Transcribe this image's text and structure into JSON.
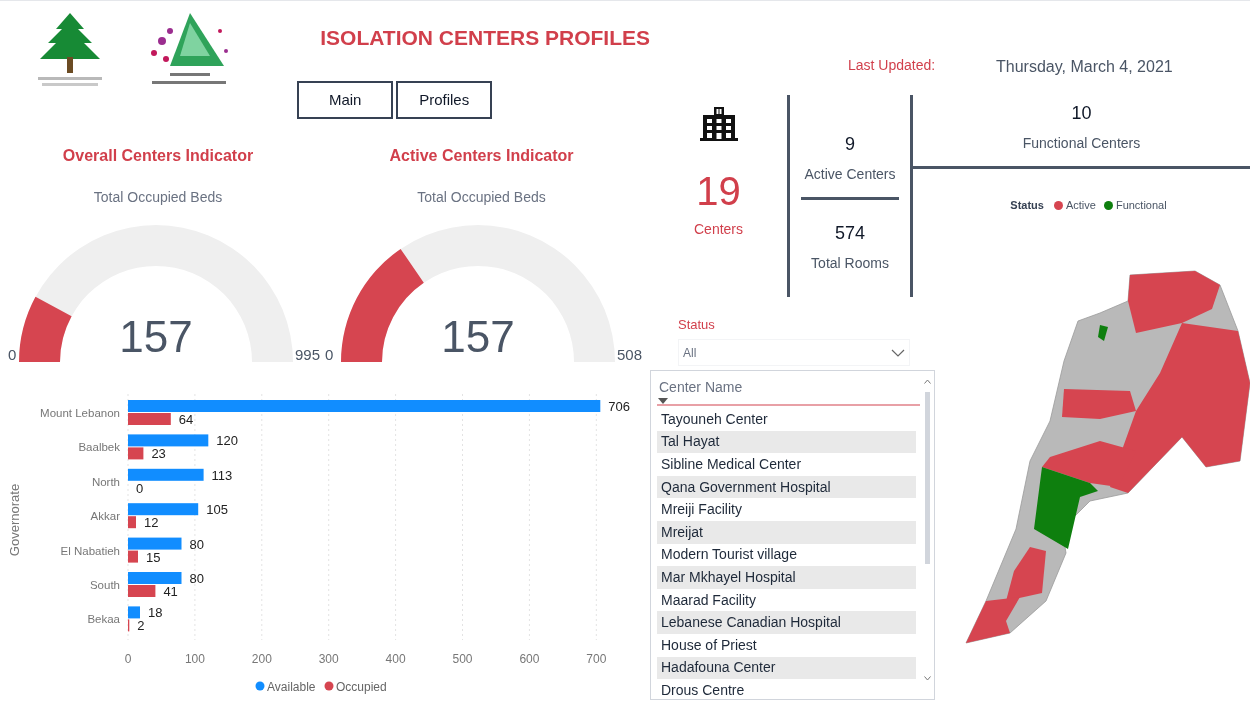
{
  "header": {
    "title": "ISOLATION CENTERS PROFILES",
    "nav_buttons": [
      {
        "label": "Main"
      },
      {
        "label": "Profiles"
      }
    ]
  },
  "last_updated": {
    "label": "Last Updated:",
    "date": "Thursday, March 4, 2021"
  },
  "gauges": [
    {
      "title": "Overall Centers Indicator",
      "subtitle": "Total Occupied Beds",
      "value": "157",
      "min": "0",
      "max": "995",
      "level": 0.158
    },
    {
      "title": "Active Centers Indicator",
      "subtitle": "Total Occupied Beds",
      "value": "157",
      "min": "0",
      "max": "508",
      "level": 0.309
    }
  ],
  "beds_chart": {
    "chart_data": {
      "type": "bar",
      "orientation": "horizontal",
      "ylabel": "Governorate",
      "categories": [
        "Mount Lebanon",
        "Baalbek",
        "North",
        "Akkar",
        "El Nabatieh",
        "South",
        "Bekaa"
      ],
      "series": [
        {
          "name": "Available",
          "color": "#118dff",
          "values": [
            706,
            120,
            113,
            105,
            80,
            80,
            18
          ]
        },
        {
          "name": "Occupied",
          "color": "#d64550",
          "values": [
            64,
            23,
            0,
            12,
            15,
            41,
            2
          ]
        }
      ],
      "xlim": [
        0,
        710
      ],
      "xticks": [
        {
          "value": 0,
          "label": "0"
        },
        {
          "value": 100,
          "label": "100"
        },
        {
          "value": 200,
          "label": "200"
        },
        {
          "value": 300,
          "label": "300"
        },
        {
          "value": 400,
          "label": "400"
        },
        {
          "value": 500,
          "label": "500"
        },
        {
          "value": 600,
          "label": "600"
        },
        {
          "value": 700,
          "label": "700"
        }
      ],
      "data_labels": true,
      "grid": true,
      "legend": true
    }
  },
  "kpis": {
    "centers": {
      "value": "19",
      "label": "Centers"
    },
    "active": {
      "value": "9",
      "label": "Active Centers"
    },
    "rooms": {
      "value": "574",
      "label": "Total Rooms"
    },
    "functional": {
      "value": "10",
      "label": "Functional Centers"
    }
  },
  "map_legend": {
    "title": "Status",
    "items": [
      {
        "label": "Active",
        "color": "#d64550"
      },
      {
        "label": "Functional",
        "color": "#0e7f0e"
      }
    ]
  },
  "status_filter": {
    "label": "Status",
    "value": "All"
  },
  "center_list": {
    "header": "Center Name",
    "items": [
      "Tayouneh Center",
      "Tal Hayat",
      "Sibline Medical Center",
      "Qana Government Hospital",
      "Mreiji Facility",
      "Mreijat",
      "Modern Tourist village",
      "Mar Mkhayel Hospital",
      "Maarad Facility",
      "Lebanese Canadian Hospital",
      "House of Priest",
      "Hadafouna Center",
      "Drous Centre"
    ]
  }
}
